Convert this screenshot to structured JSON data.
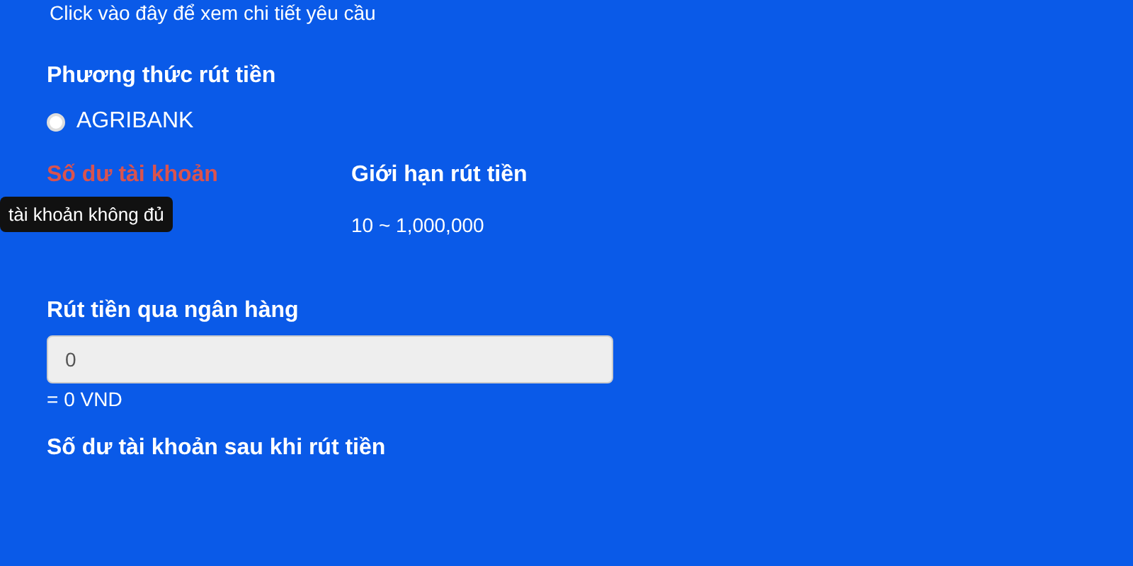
{
  "details_link": "Click vào đây để xem chi tiết yêu cầu",
  "method": {
    "heading": "Phương thức rút tiền",
    "options": [
      {
        "label": "AGRIBANK",
        "selected": false
      }
    ]
  },
  "balance": {
    "label": "Số dư tài khoản",
    "tooltip": "tài khoản không đủ"
  },
  "limit": {
    "heading": "Giới hạn rút tiền",
    "range": "10 ~ 1,000,000"
  },
  "amount": {
    "heading": "Rút tiền qua ngân hàng",
    "value": "0",
    "converted": "= 0 VND"
  },
  "after": {
    "heading": "Số dư tài khoản sau khi rút tiền"
  }
}
